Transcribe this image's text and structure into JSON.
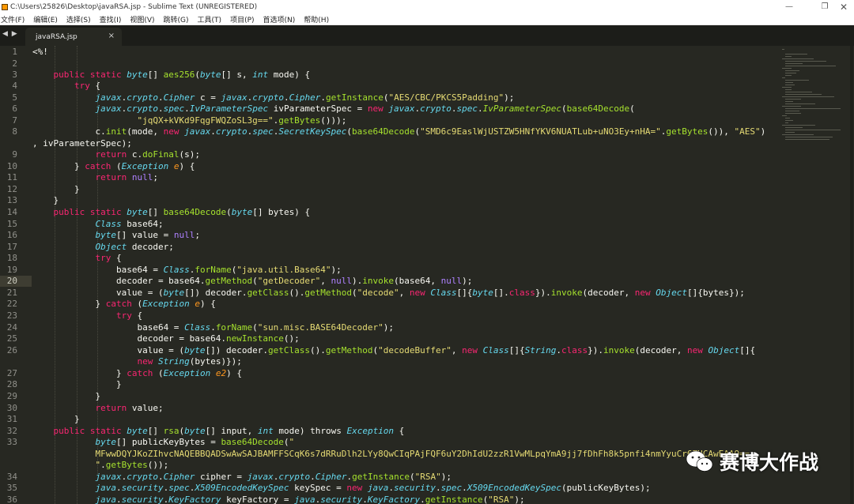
{
  "window": {
    "title": "C:\\Users\\25826\\Desktop\\javaRSA.jsp - Sublime Text (UNREGISTERED)",
    "minimize_icon": "minimize-icon",
    "maximize_icon": "restore-icon",
    "close_icon": "close-icon"
  },
  "menu": {
    "items": [
      "文件(F)",
      "编辑(E)",
      "选择(S)",
      "查找(I)",
      "视图(V)",
      "跳转(G)",
      "工具(T)",
      "项目(P)",
      "首选项(N)",
      "帮助(H)"
    ]
  },
  "tabs": {
    "nav_icons": "◀ ▶",
    "active": {
      "title": "javaRSA.jsp",
      "close_label": "×"
    }
  },
  "editor": {
    "current_line": 20,
    "gutter": [
      "1",
      "2",
      "3",
      "4",
      "5",
      "6",
      "7",
      "8",
      "",
      "9",
      "10",
      "11",
      "12",
      "13",
      "14",
      "15",
      "16",
      "17",
      "18",
      "19",
      "20",
      "21",
      "22",
      "23",
      "24",
      "25",
      "26",
      "",
      "27",
      "28",
      "29",
      "30",
      "31",
      "32",
      "33",
      "",
      "",
      "34",
      "35",
      "36"
    ],
    "colors": {
      "background": "#272822",
      "keyword": "#f92672",
      "type": "#66d9ef",
      "function": "#a6e22e",
      "string": "#e6db74",
      "constant": "#ae81ff",
      "parameter": "#fd971f"
    }
  },
  "watermark": {
    "text": "赛博大作战",
    "icon": "wechat-logo-icon"
  }
}
